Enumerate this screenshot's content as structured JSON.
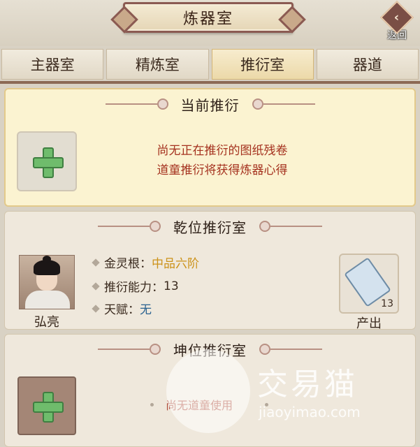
{
  "header": {
    "title": "炼器室",
    "back_label": "返回"
  },
  "tabs": [
    {
      "label": "主器室",
      "active": false
    },
    {
      "label": "精炼室",
      "active": false
    },
    {
      "label": "推衍室",
      "active": true
    },
    {
      "label": "器道",
      "active": false
    }
  ],
  "current": {
    "title": "当前推衍",
    "line1": "尚无正在推衍的图纸残卷",
    "line2": "道童推衍将获得炼器心得"
  },
  "qian": {
    "title": "乾位推衍室",
    "character_name": "弘亮",
    "attr1_label": "金灵根：",
    "attr1_value": "中品六阶",
    "attr2_label": "推衍能力：",
    "attr2_value": "13",
    "attr3_label": "天赋：",
    "attr3_value": "无",
    "output_count": "13",
    "output_label": "产出"
  },
  "kun": {
    "title": "坤位推衍室",
    "status": "尚无道童使用"
  },
  "watermark": {
    "title": "交易猫",
    "subtitle": "jiaoyimao.com"
  },
  "colors": {
    "accent_red": "#a5321f",
    "gold": "#cc9219",
    "blue": "#2a6290",
    "plus_green": "#6fbc6c"
  }
}
